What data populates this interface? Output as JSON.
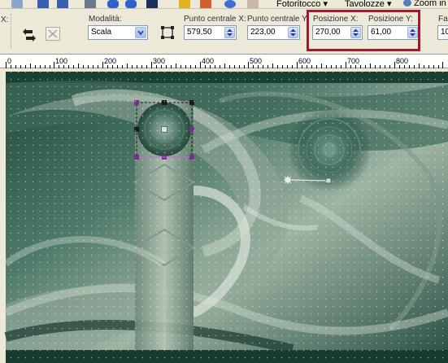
{
  "menu": {
    "photo_retouch_label": "Fotoritocco",
    "tablets_label": "Tavolozze",
    "zoom_label": "Zoom in"
  },
  "options": {
    "mode_label": "Modalità:",
    "mode_value": "Scala",
    "center_x_label": "Punto centrale X:",
    "center_x_value": "579,50",
    "center_y_label": "Punto centrale Y:",
    "center_y_value": "223,00",
    "pos_x_label": "Posizione X:",
    "pos_x_value": "270,00",
    "pos_y_label": "Posizione Y:",
    "pos_y_value": "61,00",
    "truncated_left_label": "X:",
    "truncated_right_label": "Fat",
    "truncated_right_value": "10"
  },
  "ruler": {
    "ticks": [
      "0",
      "100",
      "200",
      "300",
      "400",
      "500",
      "600",
      "700",
      "800"
    ]
  },
  "colors": {
    "highlight": "#a3182f",
    "canvas_dark": "#1f4a3c",
    "canvas_light": "#b9c7b7",
    "selection": "#7a2c8c"
  }
}
